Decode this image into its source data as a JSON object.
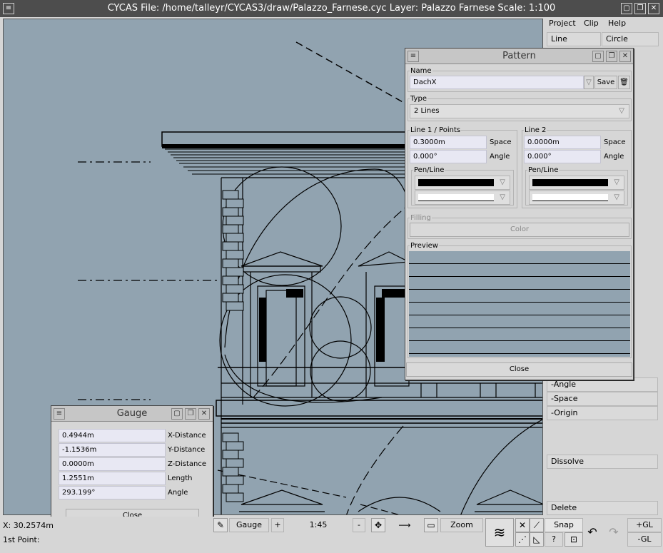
{
  "window": {
    "title": "CYCAS  File: /home/talleyr/CYCAS3/draw/Palazzo_Farnese.cyc  Layer: Palazzo Farnese  Scale: 1:100",
    "menu_icon": "window-menu-icon",
    "buttons": [
      "minimize-icon",
      "restore-icon",
      "close-icon"
    ]
  },
  "right_panel": {
    "menus": [
      "Project",
      "Clip",
      "Help"
    ],
    "tools_row": [
      "Line",
      "Circle"
    ],
    "buttons": [
      "-Angle",
      "-Space",
      "-Origin",
      "Dissolve",
      "Delete"
    ]
  },
  "pattern_dialog": {
    "title": "Pattern",
    "name_label": "Name",
    "name_value": "DachX",
    "save_label": "Save",
    "type_label": "Type",
    "type_value": "2 Lines",
    "line1": {
      "label": "Line 1 / Points",
      "space_value": "0.3000m",
      "space_label": "Space",
      "angle_value": "0.000°",
      "angle_label": "Angle",
      "pen_label": "Pen/Line"
    },
    "line2": {
      "label": "Line 2",
      "space_value": "0.0000m",
      "space_label": "Space",
      "angle_value": "0.000°",
      "angle_label": "Angle",
      "pen_label": "Pen/Line"
    },
    "filling_label": "Filling",
    "color_label": "Color",
    "preview_label": "Preview",
    "close_label": "Close"
  },
  "gauge_dialog": {
    "title": "Gauge",
    "rows": [
      {
        "value": "0.4944m",
        "label": "X-Distance"
      },
      {
        "value": "-1.1536m",
        "label": "Y-Distance"
      },
      {
        "value": "0.0000m",
        "label": "Z-Distance"
      },
      {
        "value": "1.2551m",
        "label": "Length"
      },
      {
        "value": "293.199°",
        "label": "Angle"
      }
    ],
    "close_label": "Close"
  },
  "statusbar": {
    "x_coord": "X: 30.2574m",
    "prompt": "1st Point:",
    "gauge_label": "Gauge",
    "plus_label": "+",
    "scale_value": "1:45",
    "minus_label": "-",
    "zoom_label": "Zoom",
    "snap_label": "Snap",
    "help_label": "?",
    "plus_gl": "+GL",
    "minus_gl": "-GL"
  },
  "colors": {
    "canvas": "#91a3b0",
    "titlebar": "#4d4d4d",
    "field": "#e8e8f3"
  }
}
